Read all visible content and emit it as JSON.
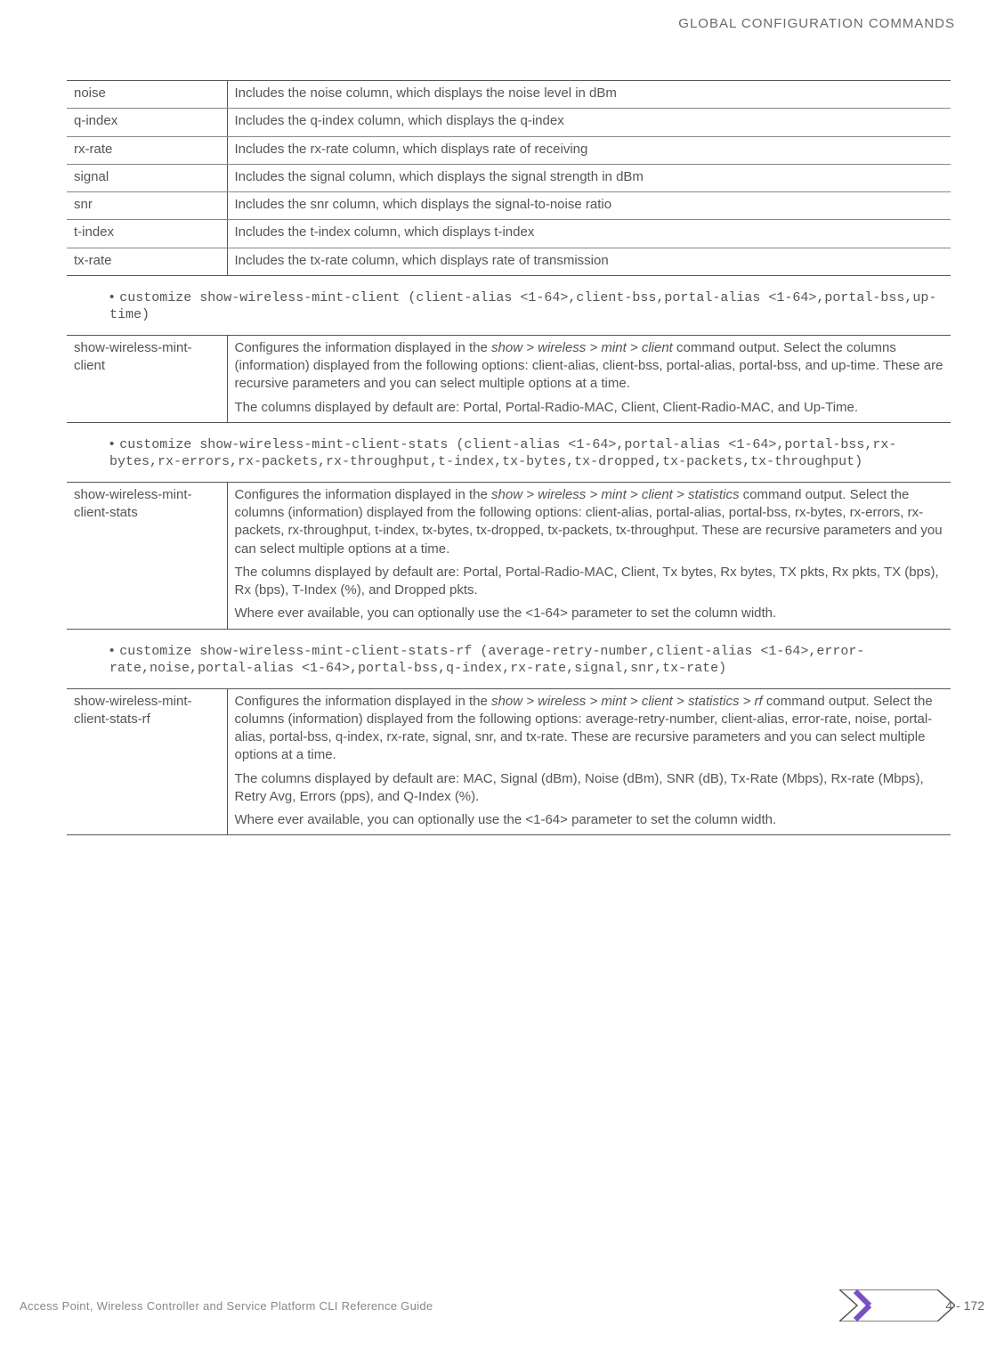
{
  "header": "GLOBAL CONFIGURATION COMMANDS",
  "table1": [
    {
      "name": "noise",
      "desc": "Includes the noise column, which displays the noise level in dBm"
    },
    {
      "name": "q-index",
      "desc": "Includes the q-index column, which displays the q-index"
    },
    {
      "name": "rx-rate",
      "desc": "Includes the rx-rate column, which displays rate of receiving"
    },
    {
      "name": "signal",
      "desc": "Includes the signal column, which displays the signal strength in dBm"
    },
    {
      "name": "snr",
      "desc": "Includes the snr column, which displays the signal-to-noise ratio"
    },
    {
      "name": "t-index",
      "desc": "Includes the t-index column, which displays t-index"
    },
    {
      "name": "tx-rate",
      "desc": "Includes the tx-rate column, which displays rate of transmission"
    }
  ],
  "bullet1": "customize show-wireless-mint-client (client-alias <1-64>,client-bss,portal-alias <1-64>,portal-bss,up-time)",
  "row_mint_client": {
    "name": "show-wireless-mint-client",
    "p1a": "Configures the information displayed in the ",
    "p1cmd": "show > wireless > mint > client",
    "p1b": " command output. Select the columns (information) displayed from the following options: client-alias, client-bss, portal-alias, portal-bss, and up-time. These are recursive parameters and you can select multiple options at a time.",
    "p2": "The columns displayed by default are: Portal, Portal-Radio-MAC, Client, Client-Radio-MAC, and Up-Time."
  },
  "bullet2": "customize show-wireless-mint-client-stats (client-alias <1-64>,portal-alias <1-64>,portal-bss,rx-bytes,rx-errors,rx-packets,rx-throughput,t-index,tx-bytes,tx-dropped,tx-packets,tx-throughput)",
  "row_mint_stats": {
    "name": "show-wireless-mint-client-stats",
    "p1a": "Configures the information displayed in the ",
    "p1cmd": "show > wireless > mint > client > statistics",
    "p1b": " command output. Select the columns (information) displayed from the following options: client-alias, portal-alias, portal-bss, rx-bytes, rx-errors, rx-packets, rx-throughput, t-index, tx-bytes, tx-dropped, tx-packets, tx-throughput. These are recursive parameters and you can select multiple options at a time.",
    "p2": "The columns displayed by default are: Portal, Portal-Radio-MAC, Client, Tx bytes, Rx bytes, TX pkts, Rx pkts, TX (bps), Rx (bps), T-Index (%), and Dropped pkts.",
    "p3": "Where ever available, you can optionally use the <1-64> parameter to set the column width."
  },
  "bullet3": "customize show-wireless-mint-client-stats-rf (average-retry-number,client-alias <1-64>,error-rate,noise,portal-alias <1-64>,portal-bss,q-index,rx-rate,signal,snr,tx-rate)",
  "row_mint_rf": {
    "name": "show-wireless-mint-client-stats-rf",
    "p1a": "Configures the information displayed in the ",
    "p1cmd": "show > wireless > mint > client > statistics > rf",
    "p1b": " command output. Select the columns (information) displayed from the following options: average-retry-number, client-alias, error-rate, noise, portal-alias, portal-bss, q-index, rx-rate, signal, snr, and tx-rate. These are recursive parameters and you can select multiple options at a time.",
    "p2": "The columns displayed by default are: MAC, Signal (dBm), Noise (dBm), SNR (dB), Tx-Rate (Mbps), Rx-rate (Mbps), Retry Avg, Errors (pps), and Q-Index (%).",
    "p3": "Where ever available, you can optionally use the <1-64> parameter to set the column width."
  },
  "footer_text": "Access Point, Wireless Controller and Service Platform CLI Reference Guide",
  "page_number": "4 - 172"
}
